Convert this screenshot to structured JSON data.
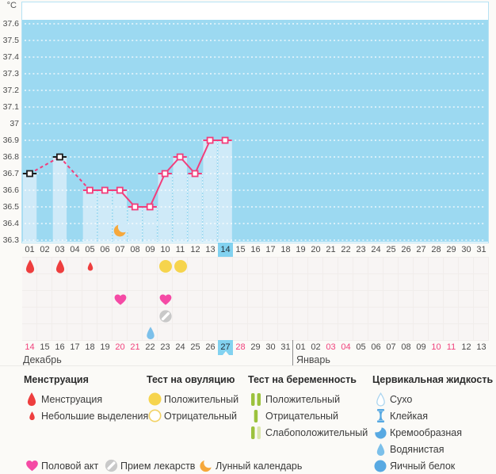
{
  "colors": {
    "plot_bg": "#9cd9f1",
    "bar": "#cfeaf8",
    "plot_border": "#b5e2f4",
    "line": "#f23d7b",
    "black_marker": "#1c1c1c",
    "highlight": "#82d2f0",
    "red": "#ee3e3e",
    "yellow": "#f6d44d",
    "yellow_outline": "#f2d264",
    "heart": "#f54aa5",
    "pill": "#c9c9c9",
    "pill_stripe": "#ffffff",
    "moon": "#f6a83b",
    "green": "#9cc23d",
    "green_light": "#dbe7ab",
    "cervical": "#58a9e2",
    "cervical_light": "#7cc0ea",
    "cervical_outline": "#a9d4ef",
    "weekend": "#f0417c",
    "page_bg": "#fbfaf7"
  },
  "chart_data": {
    "type": "bar+line",
    "unit_label": "°С",
    "y_ticks": [
      "37.6",
      "37.5",
      "37.4",
      "37.3",
      "37.2",
      "37.1",
      "37",
      "36.9",
      "36.8",
      "36.7",
      "36.6",
      "36.5",
      "36.4",
      "36.3"
    ],
    "ylim": [
      36.3,
      37.65
    ],
    "grid": "horizontal-dotted-white",
    "days": [
      "01",
      "02",
      "03",
      "04",
      "05",
      "06",
      "07",
      "08",
      "09",
      "10",
      "11",
      "12",
      "13",
      "14",
      "15",
      "16",
      "17",
      "18",
      "19",
      "20",
      "21",
      "22",
      "23",
      "24",
      "25",
      "26",
      "27",
      "28",
      "29",
      "30",
      "31"
    ],
    "selected_day": "14",
    "series": [
      {
        "name": "temperature",
        "points": [
          {
            "day": 1,
            "temp": 36.7,
            "style": "black"
          },
          {
            "day": 3,
            "temp": 36.8,
            "style": "black"
          },
          {
            "day": 5,
            "temp": 36.6,
            "style": "pink"
          },
          {
            "day": 6,
            "temp": 36.6,
            "style": "pink"
          },
          {
            "day": 7,
            "temp": 36.6,
            "style": "pink"
          },
          {
            "day": 8,
            "temp": 36.5,
            "style": "pink"
          },
          {
            "day": 9,
            "temp": 36.5,
            "style": "pink"
          },
          {
            "day": 10,
            "temp": 36.7,
            "style": "pink"
          },
          {
            "day": 11,
            "temp": 36.8,
            "style": "pink"
          },
          {
            "day": 12,
            "temp": 36.7,
            "style": "pink"
          },
          {
            "day": 13,
            "temp": 36.9,
            "style": "pink"
          },
          {
            "day": 14,
            "temp": 36.9,
            "style": "pink"
          }
        ]
      }
    ],
    "moon_day": 7
  },
  "markers": [
    {
      "day": 1,
      "row": 1,
      "icon": "drop-red",
      "name": "menstruation-icon"
    },
    {
      "day": 3,
      "row": 1,
      "icon": "drop-red",
      "name": "menstruation-icon"
    },
    {
      "day": 5,
      "row": 1,
      "icon": "drop-red-small",
      "name": "spotting-icon"
    },
    {
      "day": 10,
      "row": 1,
      "icon": "circle-yellow",
      "name": "ovulation-test-positive-icon"
    },
    {
      "day": 11,
      "row": 1,
      "icon": "circle-yellow",
      "name": "ovulation-test-positive-icon"
    },
    {
      "day": 7,
      "row": 3,
      "icon": "heart",
      "name": "intercourse-icon"
    },
    {
      "day": 10,
      "row": 3,
      "icon": "heart",
      "name": "intercourse-icon"
    },
    {
      "day": 10,
      "row": 4,
      "icon": "pill",
      "name": "medication-icon"
    },
    {
      "day": 9,
      "row": 5,
      "icon": "drop-water",
      "name": "cervical-fluid-watery-icon"
    }
  ],
  "bottom": {
    "dates": [
      {
        "label": "14",
        "weekend": true
      },
      {
        "label": "15"
      },
      {
        "label": "16"
      },
      {
        "label": "17"
      },
      {
        "label": "18"
      },
      {
        "label": "19"
      },
      {
        "label": "20",
        "weekend": true
      },
      {
        "label": "21",
        "weekend": true
      },
      {
        "label": "22"
      },
      {
        "label": "23"
      },
      {
        "label": "24"
      },
      {
        "label": "25"
      },
      {
        "label": "26"
      },
      {
        "label": "27",
        "weekend": true,
        "selected": true
      },
      {
        "label": "28",
        "weekend": true
      },
      {
        "label": "29"
      },
      {
        "label": "30"
      },
      {
        "label": "31"
      },
      {
        "label": "01"
      },
      {
        "label": "02"
      },
      {
        "label": "03",
        "weekend": true
      },
      {
        "label": "04",
        "weekend": true
      },
      {
        "label": "05"
      },
      {
        "label": "06"
      },
      {
        "label": "07"
      },
      {
        "label": "08"
      },
      {
        "label": "09"
      },
      {
        "label": "10",
        "weekend": true
      },
      {
        "label": "11",
        "weekend": true
      },
      {
        "label": "12"
      },
      {
        "label": "13"
      }
    ],
    "divider_after": 18,
    "months": [
      {
        "name": "Декабрь"
      },
      {
        "name": "Январь"
      }
    ]
  },
  "legend": {
    "columns": [
      {
        "title": "Менструация",
        "items": [
          {
            "icon": "drop-red",
            "label": "Менструация",
            "name": "menstruation-icon"
          },
          {
            "icon": "drop-red-small",
            "label": "Небольшие выделения",
            "name": "spotting-icon"
          }
        ]
      },
      {
        "title": "Тест на овуляцию",
        "items": [
          {
            "icon": "circle-yellow",
            "label": "Положительный",
            "name": "ovulation-positive-icon"
          },
          {
            "icon": "circle-yellow-outline",
            "label": "Отрицательный",
            "name": "ovulation-negative-icon"
          }
        ]
      },
      {
        "title": "Тест на беременность",
        "items": [
          {
            "icon": "bars-2",
            "label": "Положительный",
            "name": "pregnancy-positive-icon"
          },
          {
            "icon": "bars-1",
            "label": "Отрицательный",
            "name": "pregnancy-negative-icon"
          },
          {
            "icon": "bars-weak",
            "label": "Слабоположительный",
            "name": "pregnancy-weak-positive-icon"
          }
        ]
      },
      {
        "title": "Цервикальная жидкость",
        "items": [
          {
            "icon": "drop-outline",
            "label": "Сухо",
            "name": "cervical-dry-icon"
          },
          {
            "icon": "ibeam",
            "label": "Клейкая",
            "name": "cervical-sticky-icon"
          },
          {
            "icon": "cream",
            "label": "Кремообразная",
            "name": "cervical-creamy-icon"
          },
          {
            "icon": "drop-water",
            "label": "Водянистая",
            "name": "cervical-watery-icon"
          },
          {
            "icon": "circle-blue",
            "label": "Яичный белок",
            "name": "cervical-eggwhite-icon"
          }
        ]
      }
    ],
    "footer": [
      {
        "icon": "heart",
        "label": "Половой акт",
        "name": "intercourse-icon"
      },
      {
        "icon": "pill",
        "label": "Прием лекарств",
        "name": "medication-icon"
      },
      {
        "icon": "moon",
        "label": "Лунный календарь",
        "name": "moon-calendar-icon"
      }
    ]
  }
}
